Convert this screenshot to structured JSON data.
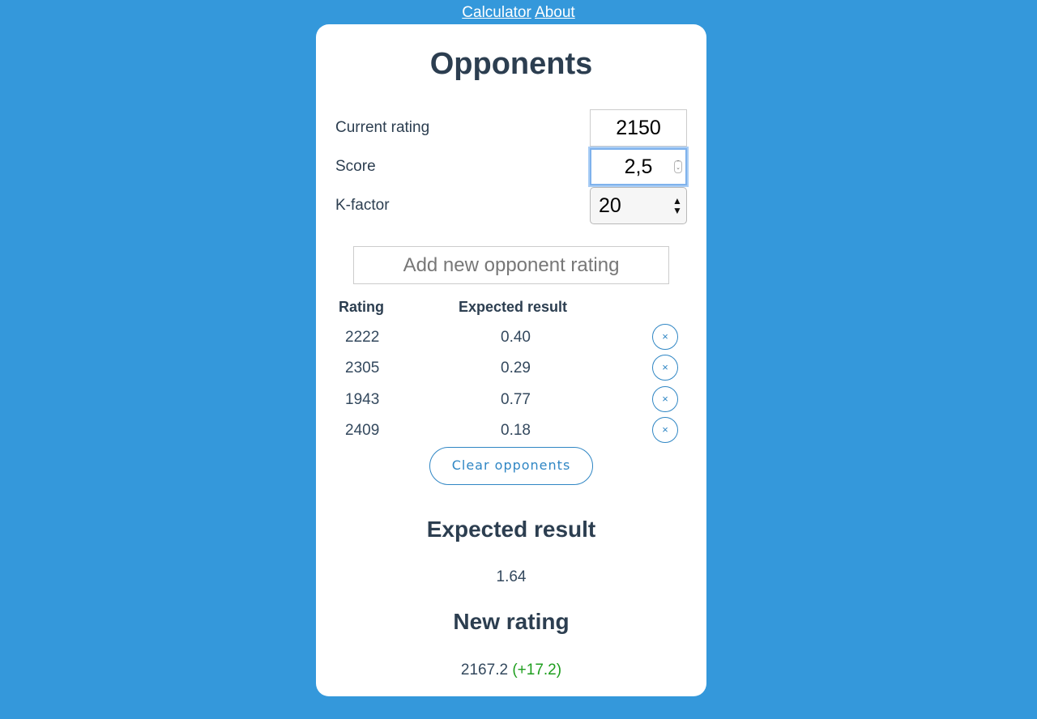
{
  "nav": {
    "links": [
      {
        "label": "Calculator"
      },
      {
        "label": "About"
      }
    ]
  },
  "page": {
    "title": "Opponents"
  },
  "form": {
    "current_rating": {
      "label": "Current rating",
      "value": "2150"
    },
    "score": {
      "label": "Score",
      "value": "2,5"
    },
    "k_factor": {
      "label": "K-factor",
      "value": "20"
    }
  },
  "add_opponent": {
    "placeholder": "Add new opponent rating",
    "value": ""
  },
  "table": {
    "headers": {
      "rating": "Rating",
      "expected": "Expected result"
    },
    "rows": [
      {
        "rating": "2222",
        "expected": "0.40",
        "remove_icon": "×"
      },
      {
        "rating": "2305",
        "expected": "0.29",
        "remove_icon": "×"
      },
      {
        "rating": "1943",
        "expected": "0.77",
        "remove_icon": "×"
      },
      {
        "rating": "2409",
        "expected": "0.18",
        "remove_icon": "×"
      }
    ]
  },
  "clear_button": {
    "label": "Clear opponents"
  },
  "expected_result": {
    "title": "Expected result",
    "value": "1.64"
  },
  "new_rating": {
    "title": "New rating",
    "value": "2167.2",
    "delta": "(+17.2)",
    "delta_color": "#1e9e1e"
  },
  "colors": {
    "background": "#3498db",
    "accent": "#2f86c4",
    "text": "#2c3e50"
  }
}
